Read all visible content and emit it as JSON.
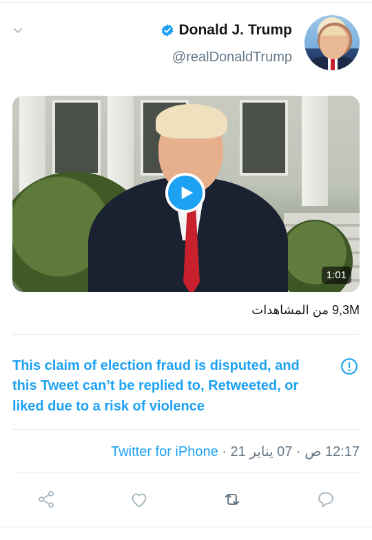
{
  "tweet": {
    "author": {
      "display_name": "Donald J. Trump",
      "handle": "@realDonaldTrump",
      "verified": true,
      "avatar_icon": "profile-photo"
    },
    "media": {
      "type": "video",
      "duration": "1:01",
      "play_icon": "play-icon"
    },
    "views": "9,3M من المشاهدات",
    "notice": {
      "text": "This claim of election fraud is disputed, and this Tweet can’t be replied to, Retweeted, or liked due to a risk of violence",
      "icon": "exclamation-circle-icon"
    },
    "meta": {
      "time": "12:17 ص",
      "separator": " · ",
      "date": "07 يناير 21",
      "source": "Twitter for iPhone"
    },
    "actions": {
      "reply_icon": "comment-icon",
      "retweet_icon": "retweet-icon",
      "like_icon": "heart-icon",
      "share_icon": "share-icon"
    }
  },
  "colors": {
    "accent": "#1da1f2",
    "text": "#14171a",
    "secondary": "#657786",
    "divider": "#e6ecf0",
    "disabled_icon": "#aab8c2"
  }
}
